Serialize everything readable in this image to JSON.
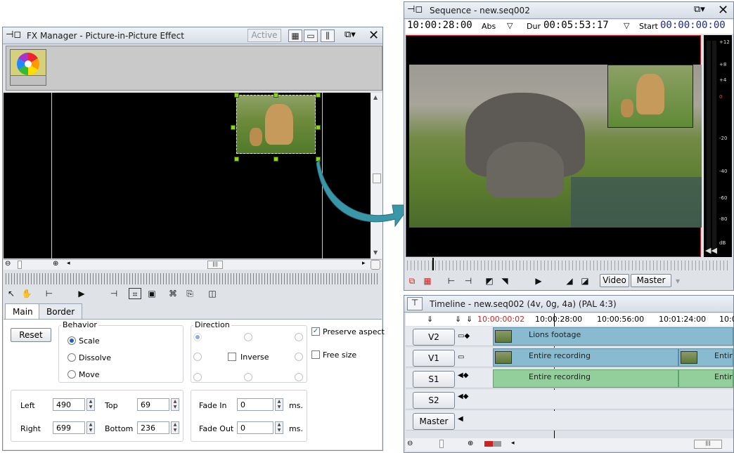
{
  "fx": {
    "title": "FX Manager - Picture-in-Picture Effect",
    "active_label": "Active",
    "tabs": [
      "Main",
      "Border"
    ],
    "reset_label": "Reset",
    "behavior_title": "Behavior",
    "behavior_options": [
      "Scale",
      "Dissolve",
      "Move"
    ],
    "behavior_selected": "Scale",
    "direction_title": "Direction",
    "inverse_label": "Inverse",
    "preserve_aspect_label": "Preserve aspect",
    "preserve_aspect_checked": true,
    "free_size_label": "Free size",
    "left_label": "Left",
    "left_value": "490",
    "top_label": "Top",
    "top_value": "69",
    "right_label": "Right",
    "right_value": "699",
    "bottom_label": "Bottom",
    "bottom_value": "236",
    "fade_in_label": "Fade In",
    "fade_in_value": "0",
    "fade_out_label": "Fade Out",
    "fade_out_value": "0",
    "ms_label": "ms.",
    "handle_color": "#8fd31c"
  },
  "sequence": {
    "title": "Sequence - new.seq002",
    "abs_time": "10:00:28:00",
    "abs_label": "Abs",
    "dur_label": "Dur",
    "dur_time": "00:05:53:17",
    "start_label": "Start",
    "start_time": "00:00:00:00",
    "video_label": "Video",
    "master_label": "Master",
    "vu_labels": [
      "+12",
      "+8",
      "+4",
      "0",
      "-20",
      "-40",
      "-60",
      "-80",
      "dB"
    ]
  },
  "timeline": {
    "title": "Timeline - new.seq002 (4v, 0g, 4a) (PAL 4:3)",
    "times": [
      "10:00:00:02",
      "10:00:28:00",
      "10:00:56:00",
      "10:01:24:00",
      "10:0"
    ],
    "tracks": [
      {
        "name": "V2",
        "clips": [
          "Lions footage"
        ]
      },
      {
        "name": "V1",
        "clips": [
          "Entire recording",
          "Entire"
        ]
      },
      {
        "name": "S1",
        "clips": [
          "Entire recording",
          "Entire"
        ]
      },
      {
        "name": "S2",
        "clips": []
      },
      {
        "name": "Master",
        "clips": []
      }
    ],
    "video_clip_color": "#88bbd0",
    "audio_clip_color": "#93cf9a"
  }
}
